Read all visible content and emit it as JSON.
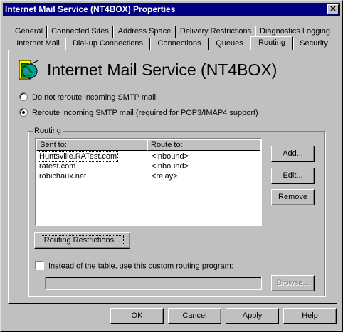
{
  "window": {
    "title": "Internet Mail Service (NT4BOX) Properties",
    "close_glyph": "✕"
  },
  "tabs_row1": [
    {
      "label": "General"
    },
    {
      "label": "Connected Sites"
    },
    {
      "label": "Address Space"
    },
    {
      "label": "Delivery Restrictions"
    },
    {
      "label": "Diagnostics Logging"
    }
  ],
  "tabs_row2": [
    {
      "label": "Internet Mail"
    },
    {
      "label": "Dial-up Connections"
    },
    {
      "label": "Connections"
    },
    {
      "label": "Queues"
    },
    {
      "label": "Routing",
      "active": true
    },
    {
      "label": "Security"
    }
  ],
  "header": {
    "title": "Internet Mail Service (NT4BOX)",
    "icon": "mail-service-icon"
  },
  "options": {
    "do_not_reroute": {
      "label": "Do not reroute incoming SMTP mail",
      "checked": false
    },
    "reroute": {
      "label": "Reroute incoming SMTP mail (required for POP3/IMAP4 support)",
      "checked": true
    }
  },
  "routing": {
    "group_label": "Routing",
    "columns": {
      "sent_to": "Sent to:",
      "route_to": "Route to:"
    },
    "rows": [
      {
        "sent_to": "Huntsville.RATest.com",
        "route_to": "<inbound>",
        "selected": true
      },
      {
        "sent_to": "ratest.com",
        "route_to": "<inbound>"
      },
      {
        "sent_to": "robichaux.net",
        "route_to": "<relay>"
      }
    ],
    "buttons": {
      "add": "Add...",
      "edit": "Edit...",
      "remove": "Remove"
    },
    "restrictions_button": "Routing Restrictions...",
    "custom_program_label": "Instead of the table, use this custom routing program:",
    "custom_program_value": "",
    "browse_button": "Browse..."
  },
  "footer": {
    "ok": "OK",
    "cancel": "Cancel",
    "apply": "Apply",
    "help": "Help"
  }
}
